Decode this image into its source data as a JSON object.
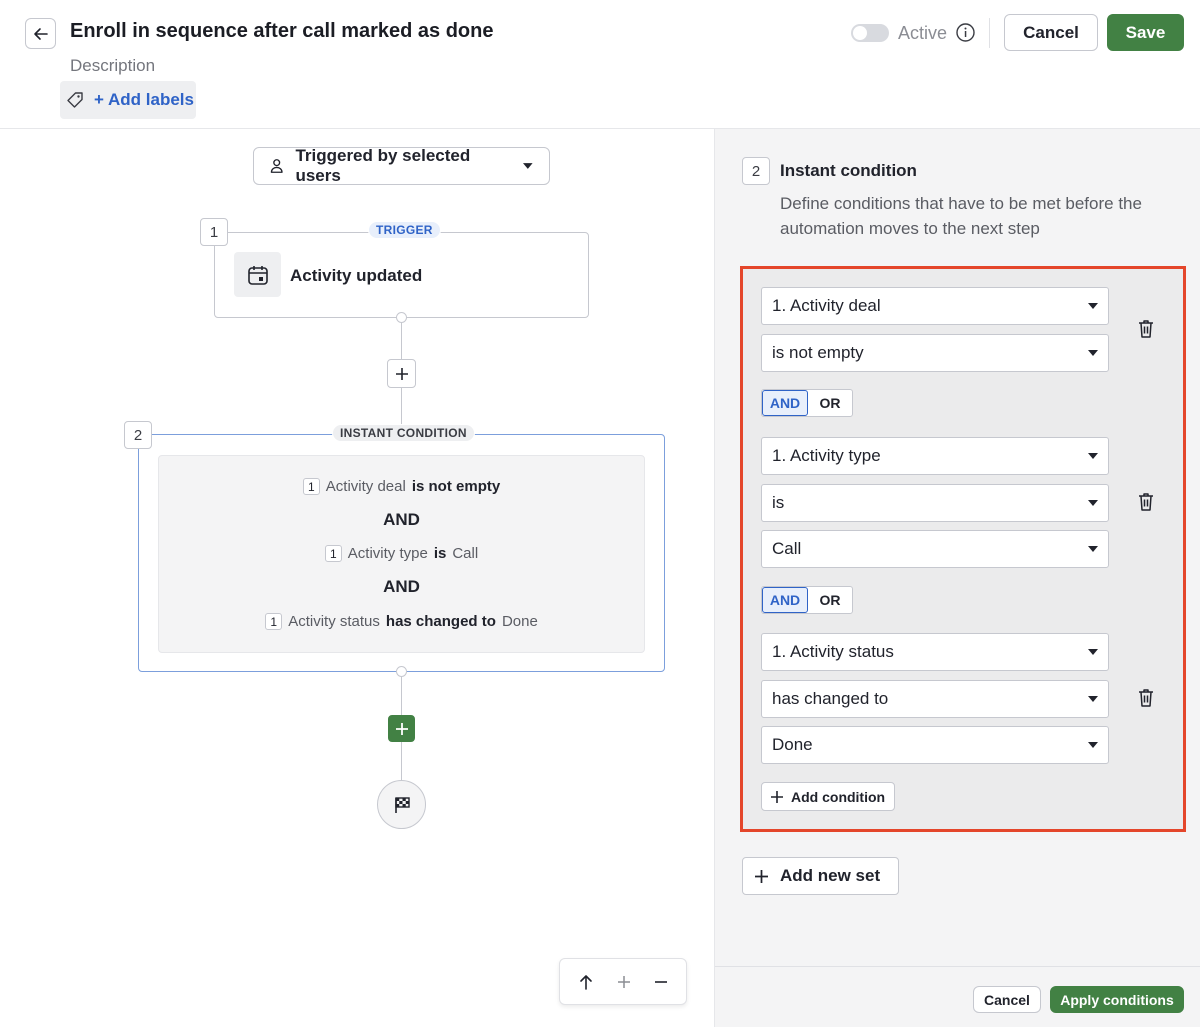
{
  "header": {
    "title": "Enroll in sequence after call marked as done",
    "description": "Description",
    "add_labels": "+ Add labels",
    "active_label": "Active",
    "cancel": "Cancel",
    "save": "Save"
  },
  "canvas": {
    "trigger_selector": "Triggered by selected users",
    "step1": {
      "number": "1",
      "badge": "TRIGGER",
      "title": "Activity updated"
    },
    "step2": {
      "number": "2",
      "badge": "INSTANT CONDITION",
      "conditions": [
        {
          "ref": "1",
          "field": "Activity deal",
          "operator": "is not empty",
          "value": ""
        },
        {
          "ref": "1",
          "field": "Activity type",
          "operator": "is",
          "value": "Call"
        },
        {
          "ref": "1",
          "field": "Activity status",
          "operator": "has changed to",
          "value": "Done"
        }
      ],
      "joiner": "AND"
    }
  },
  "panel": {
    "number": "2",
    "title": "Instant condition",
    "description": "Define conditions that have to be met before the automation moves to the next step",
    "conditions": [
      {
        "field": "1. Activity deal",
        "operator": "is not empty"
      },
      {
        "field": "1. Activity type",
        "operator": "is",
        "value": "Call"
      },
      {
        "field": "1. Activity status",
        "operator": "has changed to",
        "value": "Done"
      }
    ],
    "and_label": "AND",
    "or_label": "OR",
    "add_condition": "Add condition",
    "add_new_set": "Add new set",
    "footer_cancel": "Cancel",
    "apply_conditions": "Apply conditions"
  },
  "colors": {
    "primary_green": "#428144",
    "link_blue": "#2f63c7",
    "highlight_red": "#e4462b"
  }
}
